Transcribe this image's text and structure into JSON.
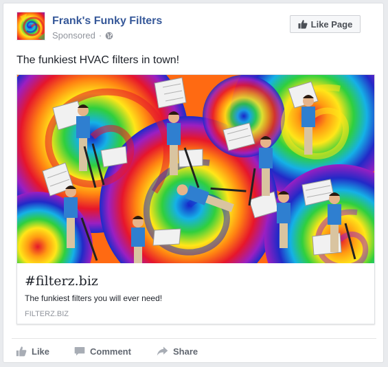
{
  "header": {
    "page_name": "Frank's Funky Filters",
    "sponsored_label": "Sponsored",
    "separator": "·",
    "globe_icon": "globe-icon",
    "like_page_label": "Like Page",
    "like_icon": "thumbs-up-icon"
  },
  "post": {
    "caption": "The funkiest HVAC filters in town!"
  },
  "link_preview": {
    "title": "#filterz.biz",
    "description": "The funkiest filters you will ever need!",
    "domain": "FILTERZ.BIZ",
    "image_description_icon": "tie-dye-ad-image"
  },
  "actions": {
    "like_label": "Like",
    "comment_label": "Comment",
    "share_label": "Share"
  },
  "colors": {
    "page_name": "#365899",
    "secondary_text": "#90949c",
    "action_text": "#616770",
    "background": "#e9ebee"
  }
}
